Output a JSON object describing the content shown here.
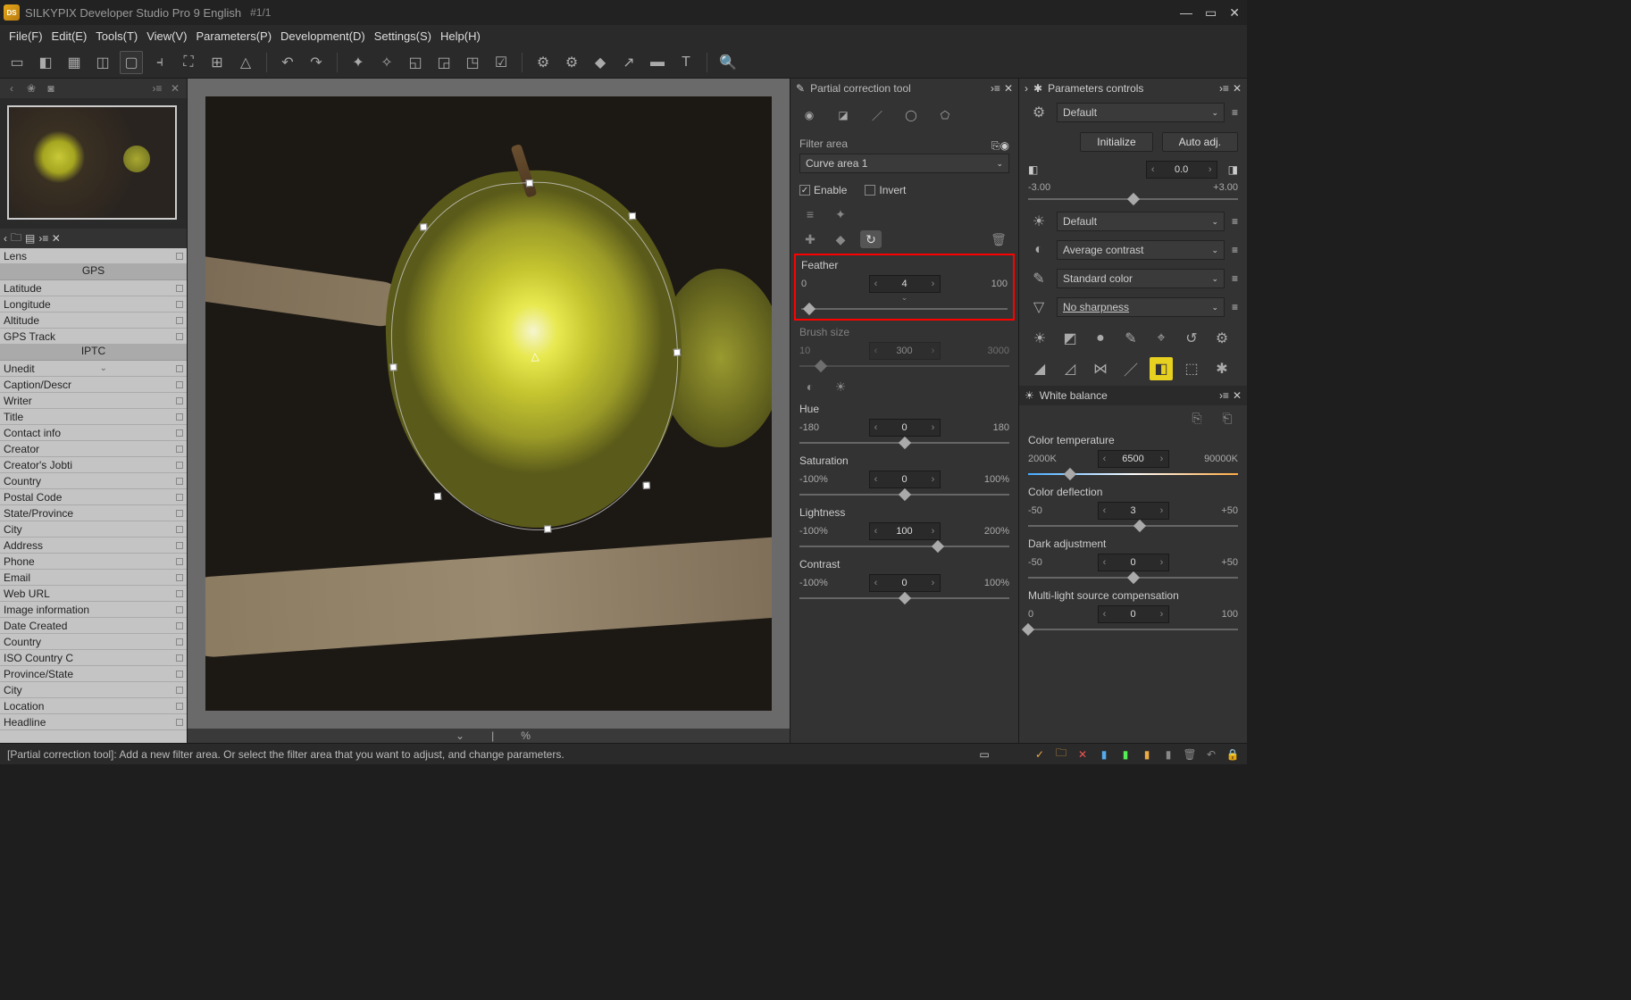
{
  "titlebar": {
    "app": "SILKYPIX Developer Studio Pro 9 English",
    "page": "#1/1"
  },
  "menu": {
    "file": "File(F)",
    "edit": "Edit(E)",
    "tools": "Tools(T)",
    "view": "View(V)",
    "params": "Parameters(P)",
    "dev": "Development(D)",
    "settings": "Settings(S)",
    "help": "Help(H)"
  },
  "meta": {
    "lens": "Lens",
    "sec_gps": "GPS",
    "latitude": "Latitude",
    "longitude": "Longitude",
    "altitude": "Altitude",
    "gpstrack": "GPS Track",
    "sec_iptc": "IPTC",
    "unedit": "Unedit",
    "caption": "Caption/Descr",
    "writer": "Writer",
    "titlef": "Title",
    "contact": "Contact info",
    "creator": "Creator",
    "creatorsjob": "Creator's Jobti",
    "country": "Country",
    "postal": "Postal Code",
    "state": "State/Province",
    "city": "City",
    "address": "Address",
    "phone": "Phone",
    "email": "Email",
    "weburl": "Web URL",
    "imageinfo": "Image information",
    "datecreated": "Date Created",
    "country2": "Country",
    "isocountry": "ISO Country C",
    "province": "Province/State",
    "city2": "City",
    "location": "Location",
    "headline": "Headline"
  },
  "partial": {
    "title": "Partial correction tool",
    "filterarea": "Filter area",
    "curvearea": "Curve area 1",
    "enable": "Enable",
    "invert": "Invert",
    "feather": {
      "label": "Feather",
      "min": "0",
      "val": "4",
      "max": "100",
      "pos": 4
    },
    "brush": {
      "label": "Brush size",
      "min": "10",
      "val": "300",
      "max": "3000",
      "pos": 10
    },
    "hue": {
      "label": "Hue",
      "min": "-180",
      "val": "0",
      "max": "180",
      "pos": 50
    },
    "sat": {
      "label": "Saturation",
      "min": "-100%",
      "val": "0",
      "max": "100%",
      "pos": 50
    },
    "light": {
      "label": "Lightness",
      "min": "-100%",
      "val": "100",
      "max": "200%",
      "pos": 66
    },
    "contrast": {
      "label": "Contrast",
      "min": "-100%",
      "val": "0",
      "max": "100%",
      "pos": 50
    }
  },
  "params": {
    "title": "Parameters controls",
    "preset": "Default",
    "init": "Initialize",
    "autoadj": "Auto adj.",
    "ev": {
      "min": "-3.00",
      "val": "0.0",
      "max": "+3.00",
      "pos": 50
    },
    "wbpreset": "Default",
    "contrastpreset": "Average contrast",
    "colorpreset": "Standard color",
    "sharp": "No sharpness",
    "wbtitle": "White balance",
    "temp": {
      "label": "Color temperature",
      "min": "2000K",
      "val": "6500",
      "max": "90000K",
      "pos": 20
    },
    "defl": {
      "label": "Color deflection",
      "min": "-50",
      "val": "3",
      "max": "+50",
      "pos": 53
    },
    "dark": {
      "label": "Dark adjustment",
      "min": "-50",
      "val": "0",
      "max": "+50",
      "pos": 50
    },
    "multi": {
      "label": "Multi-light source compensation",
      "min": "0",
      "val": "0",
      "max": "100",
      "pos": 0
    }
  },
  "hscroll": {
    "pct": "%"
  },
  "status": {
    "msg": "[Partial correction tool]: Add a new filter area. Or select the filter area that you want to adjust, and change parameters."
  }
}
